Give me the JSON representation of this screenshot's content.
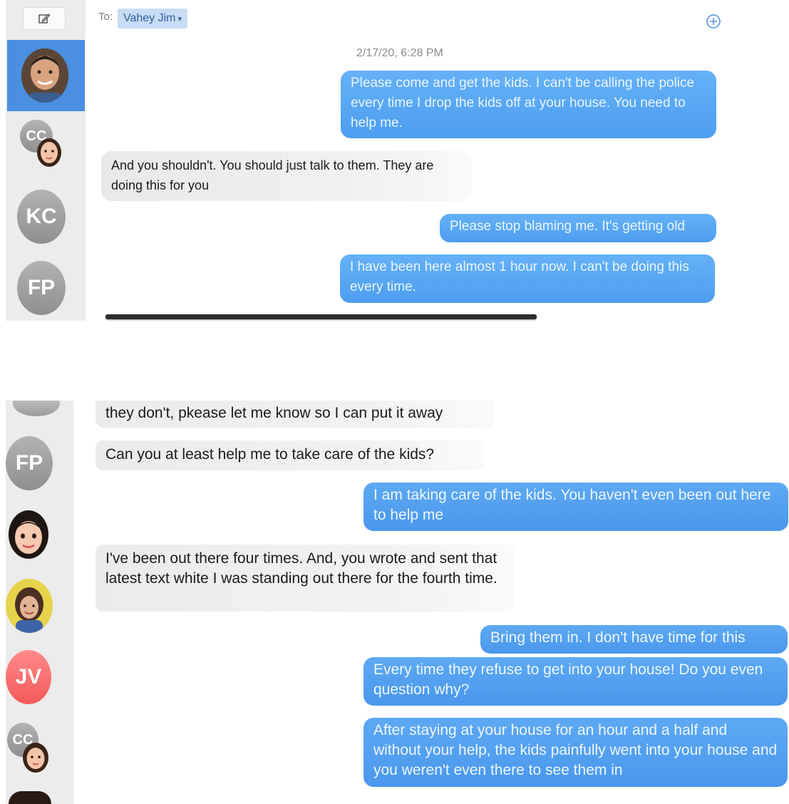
{
  "top": {
    "recipient_label": "To:",
    "recipient_name": "Vahey Jim",
    "recipient_chevron": "▾",
    "timestamp": "2/17/20, 6:28 PM",
    "contacts": [
      {
        "initials": "CC"
      },
      {
        "initials": "KC"
      },
      {
        "initials": "FP"
      }
    ],
    "messages": [
      {
        "dir": "out",
        "text": "Please come and get the kids. I can't be calling the police every time I drop the kids off at your house. You need to help me."
      },
      {
        "dir": "in",
        "text": "And you shouldn't. You should just talk to them. They are doing this for you"
      },
      {
        "dir": "out",
        "text": "Please stop blaming me. It's getting old"
      },
      {
        "dir": "out",
        "text": "I have been here almost 1 hour now. I can't be doing this every time."
      }
    ]
  },
  "bottom": {
    "contacts": [
      {
        "initials": "FP"
      },
      {
        "initials": "JV"
      },
      {
        "initials": "CC"
      }
    ],
    "messages": [
      {
        "dir": "in",
        "text": "they don't, pkease let me know so I can put it away"
      },
      {
        "dir": "in",
        "text": "Can you at least help me to take care of the kids?"
      },
      {
        "dir": "out",
        "text": "I am taking care of the kids. You haven't even been out here to help me"
      },
      {
        "dir": "in",
        "text": "I've been out there four times.  And, you wrote and sent that latest text white I was standing out there for the fourth time."
      },
      {
        "dir": "out",
        "text": "Bring them in. I don't have time for this"
      },
      {
        "dir": "out",
        "text": "Every time they refuse to get into your house! Do you even question why?"
      },
      {
        "dir": "out",
        "text": "After staying at your house for an hour and a half and without your help, the kids painfully went into your house and you weren't even there to see them in"
      }
    ]
  },
  "colors": {
    "outgoing_bubble": "#4e9ef0",
    "incoming_bubble": "#ececec",
    "selected_row": "#4a8fe0",
    "gray_avatar": "#a0a0a0",
    "red_avatar": "#f35a5a"
  },
  "icons": {
    "compose": "compose-icon",
    "add": "add-circle-icon"
  }
}
